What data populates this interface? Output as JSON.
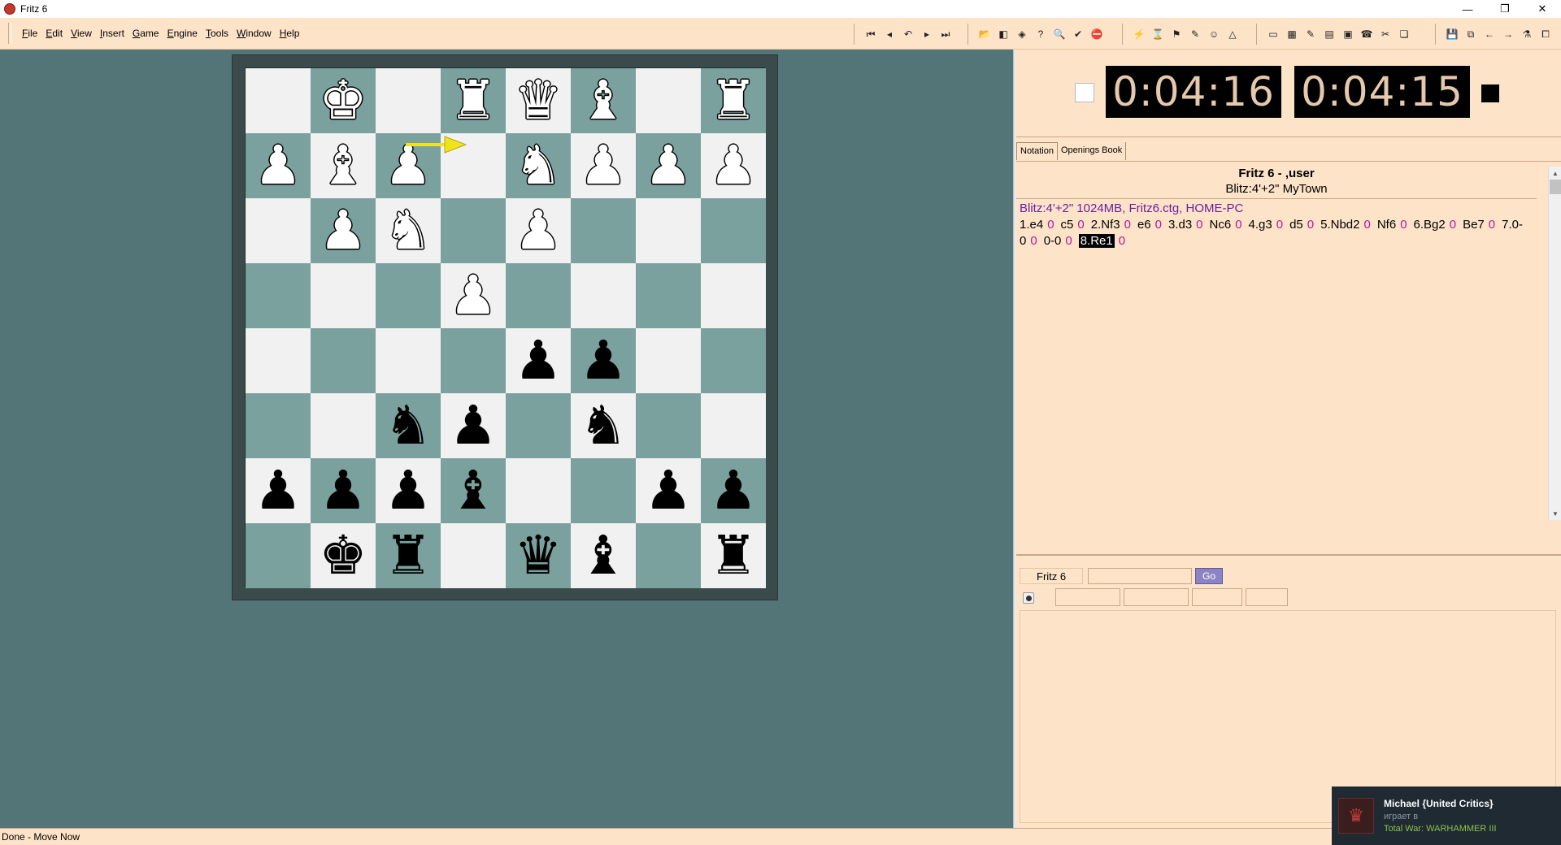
{
  "window": {
    "title": "Fritz 6",
    "minimize": "—",
    "restore": "❐",
    "close": "✕"
  },
  "menu": [
    {
      "label": "File",
      "key": "F",
      "rest": "ile"
    },
    {
      "label": "Edit",
      "key": "E",
      "rest": "dit"
    },
    {
      "label": "View",
      "key": "V",
      "rest": "iew"
    },
    {
      "label": "Insert",
      "key": "I",
      "rest": "nsert"
    },
    {
      "label": "Game",
      "key": "G",
      "rest": "ame"
    },
    {
      "label": "Engine",
      "key": "E",
      "rest": "ngine"
    },
    {
      "label": "Tools",
      "key": "T",
      "rest": "ools"
    },
    {
      "label": "Window",
      "key": "W",
      "rest": "indow"
    },
    {
      "label": "Help",
      "key": "H",
      "rest": "elp"
    }
  ],
  "toolbar": {
    "nav": [
      "⏮",
      "◂",
      "↶",
      "▸",
      "⏭"
    ],
    "game": [
      "📂",
      "◧",
      "◈",
      "?",
      "🔍",
      "✔",
      "⛔"
    ],
    "engine": [
      "⚡",
      "⌛",
      "⚑",
      "✎",
      "☺",
      "△"
    ],
    "view": [
      "▭",
      "▦",
      "✎",
      "▤",
      "▣",
      "☎",
      "✂",
      "❏"
    ],
    "file": [
      "💾",
      "⧉",
      "←",
      "→",
      "⚗",
      "⧠"
    ]
  },
  "board": {
    "rows": [
      [
        "",
        "wK",
        "",
        "wR",
        "wQ",
        "wB",
        "",
        "wR"
      ],
      [
        "wP",
        "wB",
        "wP",
        "",
        "wN",
        "wP",
        "wP",
        "wP"
      ],
      [
        "",
        "wP",
        "wN",
        "",
        "wP",
        "",
        "",
        ""
      ],
      [
        "",
        "",
        "",
        "wP",
        "",
        "",
        "",
        ""
      ],
      [
        "",
        "",
        "",
        "",
        "bP",
        "bP",
        "",
        ""
      ],
      [
        "",
        "",
        "bN",
        "bP",
        "",
        "bN",
        "",
        ""
      ],
      [
        "bP",
        "bP",
        "bP",
        "bB",
        "",
        "",
        "bP",
        "bP"
      ],
      [
        "",
        "bK",
        "bR",
        "",
        "bQ",
        "bB",
        "",
        "bR"
      ]
    ],
    "colors": {
      "light": "#f1f1f1",
      "dark": "#7aa19e"
    },
    "last_move_arrow": {
      "from": "e1",
      "to": "d1",
      "color": "#f2e21b"
    }
  },
  "clocks": {
    "white": "0:04:16",
    "black": "0:04:15"
  },
  "tabs": [
    {
      "label": "Notation",
      "active": true
    },
    {
      "label": "Openings Book",
      "active": false
    }
  ],
  "notation": {
    "title": "Fritz 6 - ,user",
    "subtitle": "Blitz:4'+2\" MyTown",
    "header": "Blitz:4'+2\"  1024MB, Fritz6.ctg, HOME-PC",
    "moves": [
      {
        "text": "1.e4",
        "eval": "0"
      },
      {
        "text": "c5",
        "eval": "0"
      },
      {
        "text": "2.Nf3",
        "eval": "0"
      },
      {
        "text": "e6",
        "eval": "0"
      },
      {
        "text": "3.d3",
        "eval": "0"
      },
      {
        "text": "Nc6",
        "eval": "0"
      },
      {
        "text": "4.g3",
        "eval": "0"
      },
      {
        "text": "d5",
        "eval": "0"
      },
      {
        "text": "5.Nbd2",
        "eval": "0"
      },
      {
        "text": "Nf6",
        "eval": "0"
      },
      {
        "text": "6.Bg2",
        "eval": "0"
      },
      {
        "text": "Be7",
        "eval": "0"
      },
      {
        "text": "7.0-0",
        "eval": "0"
      },
      {
        "text": "0-0",
        "eval": "0"
      },
      {
        "text": "8.Re1",
        "eval": "0",
        "current": true
      }
    ]
  },
  "engine": {
    "name": "Fritz 6",
    "go_label": "Go"
  },
  "status": {
    "text": "Done - Move Now"
  },
  "notification": {
    "name": "Michael {United Critics}",
    "status": "играет в",
    "game": "Total War: WARHAMMER III"
  }
}
